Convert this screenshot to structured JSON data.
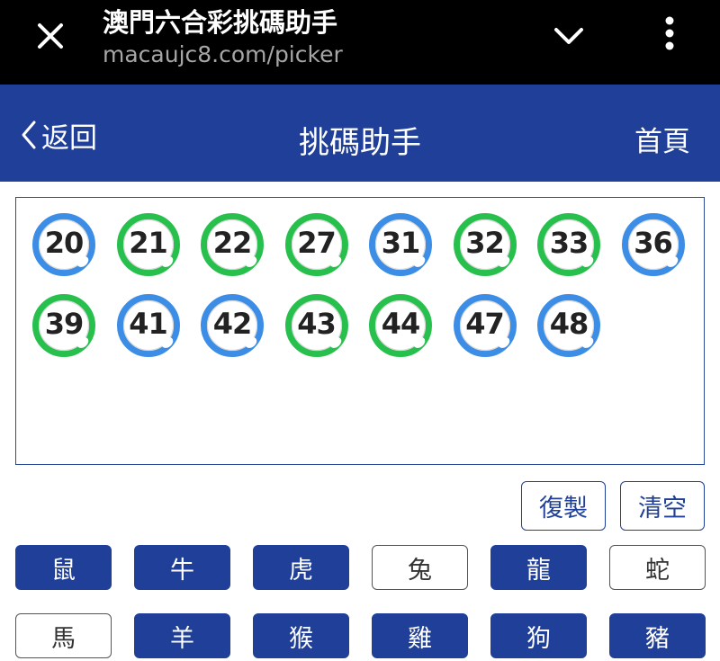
{
  "browser": {
    "title": "澳門六合彩挑碼助手",
    "url": "macaujc8.com/picker",
    "icons": {
      "close": "close-icon",
      "dropdown": "chevron-down-icon",
      "menu": "more-vertical-icon"
    }
  },
  "header": {
    "back_label": "返回",
    "title": "挑碼助手",
    "home_label": "首頁"
  },
  "colors": {
    "brand": "#1f3f98",
    "ball_blue": "#3b8de5",
    "ball_green": "#27c04d"
  },
  "picked": [
    {
      "num": "20",
      "color": "blue"
    },
    {
      "num": "21",
      "color": "green"
    },
    {
      "num": "22",
      "color": "green"
    },
    {
      "num": "27",
      "color": "green"
    },
    {
      "num": "31",
      "color": "blue"
    },
    {
      "num": "32",
      "color": "green"
    },
    {
      "num": "33",
      "color": "green"
    },
    {
      "num": "36",
      "color": "blue"
    },
    {
      "num": "39",
      "color": "green"
    },
    {
      "num": "41",
      "color": "blue"
    },
    {
      "num": "42",
      "color": "blue"
    },
    {
      "num": "43",
      "color": "green"
    },
    {
      "num": "44",
      "color": "green"
    },
    {
      "num": "47",
      "color": "blue"
    },
    {
      "num": "48",
      "color": "blue"
    }
  ],
  "actions": {
    "copy_label": "復製",
    "clear_label": "清空"
  },
  "zodiacs": [
    {
      "label": "鼠",
      "selected": true
    },
    {
      "label": "牛",
      "selected": true
    },
    {
      "label": "虎",
      "selected": true
    },
    {
      "label": "兔",
      "selected": false
    },
    {
      "label": "龍",
      "selected": true
    },
    {
      "label": "蛇",
      "selected": false
    },
    {
      "label": "馬",
      "selected": false
    },
    {
      "label": "羊",
      "selected": true
    },
    {
      "label": "猴",
      "selected": true
    },
    {
      "label": "雞",
      "selected": true
    },
    {
      "label": "狗",
      "selected": true
    },
    {
      "label": "豬",
      "selected": true
    }
  ]
}
